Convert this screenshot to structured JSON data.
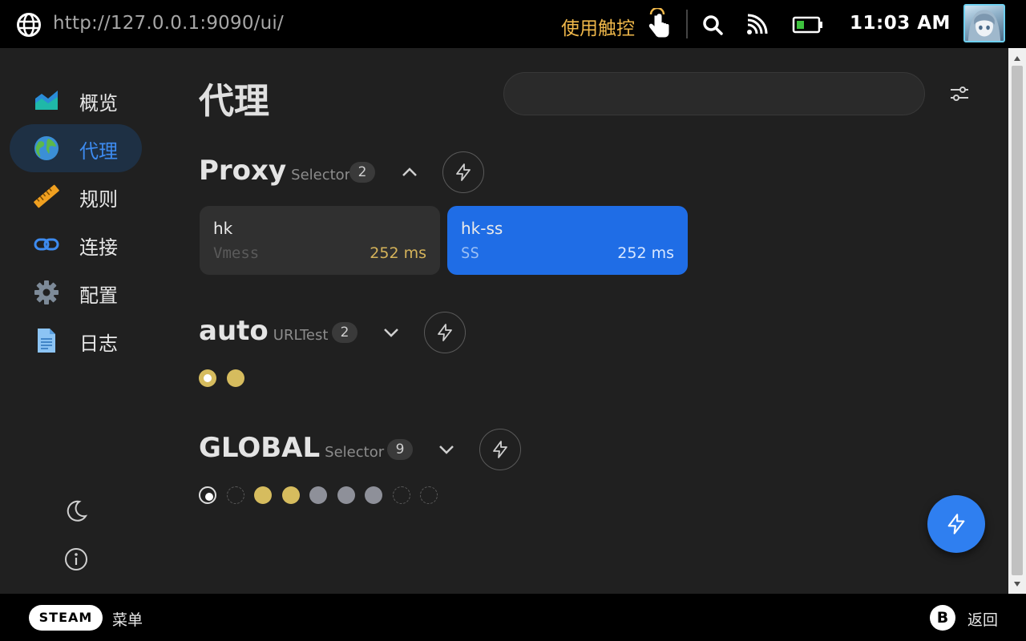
{
  "topbar": {
    "url": "http://127.0.0.1:9090/ui/",
    "touch_label": "使用触控",
    "time": "11:03 AM"
  },
  "sidebar": {
    "items": [
      {
        "label": "概览",
        "icon": "chart-icon"
      },
      {
        "label": "代理",
        "icon": "earth-icon",
        "active": true
      },
      {
        "label": "规则",
        "icon": "ruler-icon"
      },
      {
        "label": "连接",
        "icon": "link-icon"
      },
      {
        "label": "配置",
        "icon": "gear-icon"
      },
      {
        "label": "日志",
        "icon": "document-icon"
      }
    ],
    "bottom_icons": [
      "moon-icon",
      "info-icon"
    ]
  },
  "main": {
    "title": "代理",
    "search": {
      "value": "",
      "placeholder": ""
    },
    "groups": [
      {
        "name": "Proxy",
        "type": "Selector",
        "count": "2",
        "expanded": true,
        "proxies": [
          {
            "name": "hk",
            "type": "Vmess",
            "latency": "252 ms",
            "selected": false
          },
          {
            "name": "hk-ss",
            "type": "SS",
            "latency": "252 ms",
            "selected": true
          }
        ]
      },
      {
        "name": "auto",
        "type": "URLTest",
        "count": "2",
        "expanded": false,
        "dots": [
          "gold-current",
          "gold"
        ]
      },
      {
        "name": "GLOBAL",
        "type": "Selector",
        "count": "9",
        "expanded": false,
        "dots": [
          "ring-current",
          "empty",
          "gold",
          "gold",
          "gray",
          "gray",
          "gray",
          "empty",
          "empty"
        ]
      }
    ]
  },
  "colors": {
    "accent": "#1f6de6",
    "latency": "#d5b35a",
    "touch": "#f0b84a",
    "active_nav_bg": "#1e3044"
  },
  "bottombar": {
    "steam_label": "STEAM",
    "menu_label": "菜单",
    "b_label": "B",
    "back_label": "返回"
  }
}
